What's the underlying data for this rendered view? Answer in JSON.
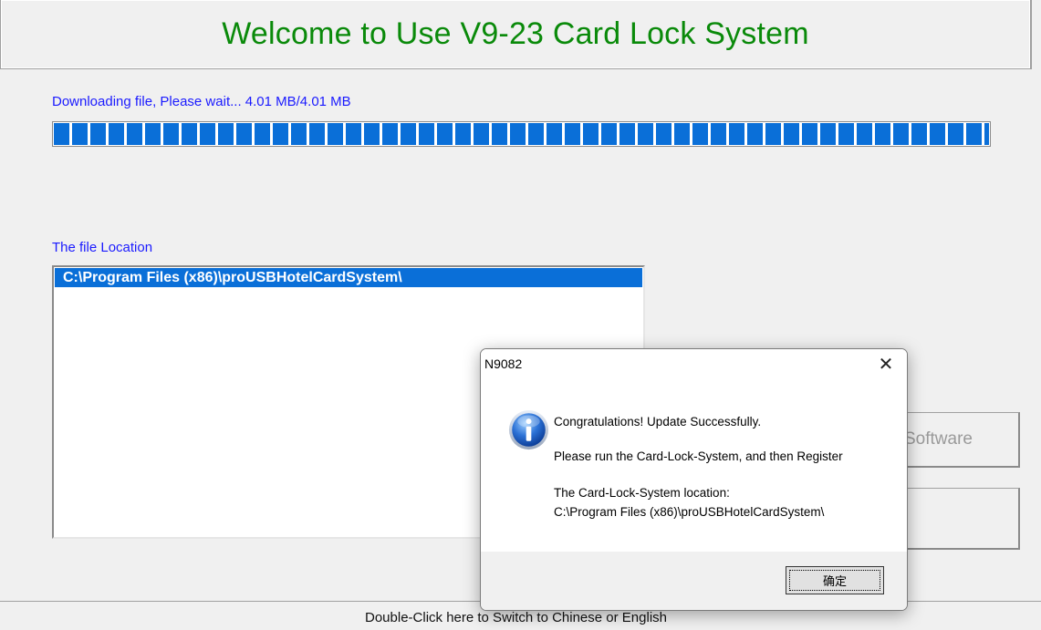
{
  "app": {
    "title": "Welcome to Use V9-23 Card Lock System",
    "download_status": "Downloading file, Please wait... 4.01 MB/4.01 MB",
    "progress_percent": 100,
    "file_location_label": "The file Location",
    "file_locations": [
      "C:\\Program Files (x86)\\proUSBHotelCardSystem\\"
    ],
    "side_button_1_label": "Software",
    "side_button_2_label": "",
    "status_bar_text": "Double-Click here to Switch to Chinese or English"
  },
  "dialog": {
    "title": "N9082",
    "close_glyph": "✕",
    "icon": "info-icon",
    "line1": "Congratulations! Update Successfully.",
    "line2": "Please run the Card-Lock-System, and then Register",
    "line3": "The Card-Lock-System location:",
    "line4": "C:\\Program Files (x86)\\proUSBHotelCardSystem\\",
    "ok_label": "确定"
  },
  "colors": {
    "title_green": "#0a8a0a",
    "label_blue": "#1a1aff",
    "progress_blue": "#0a6fd8",
    "selection_blue": "#0a6fd8"
  }
}
